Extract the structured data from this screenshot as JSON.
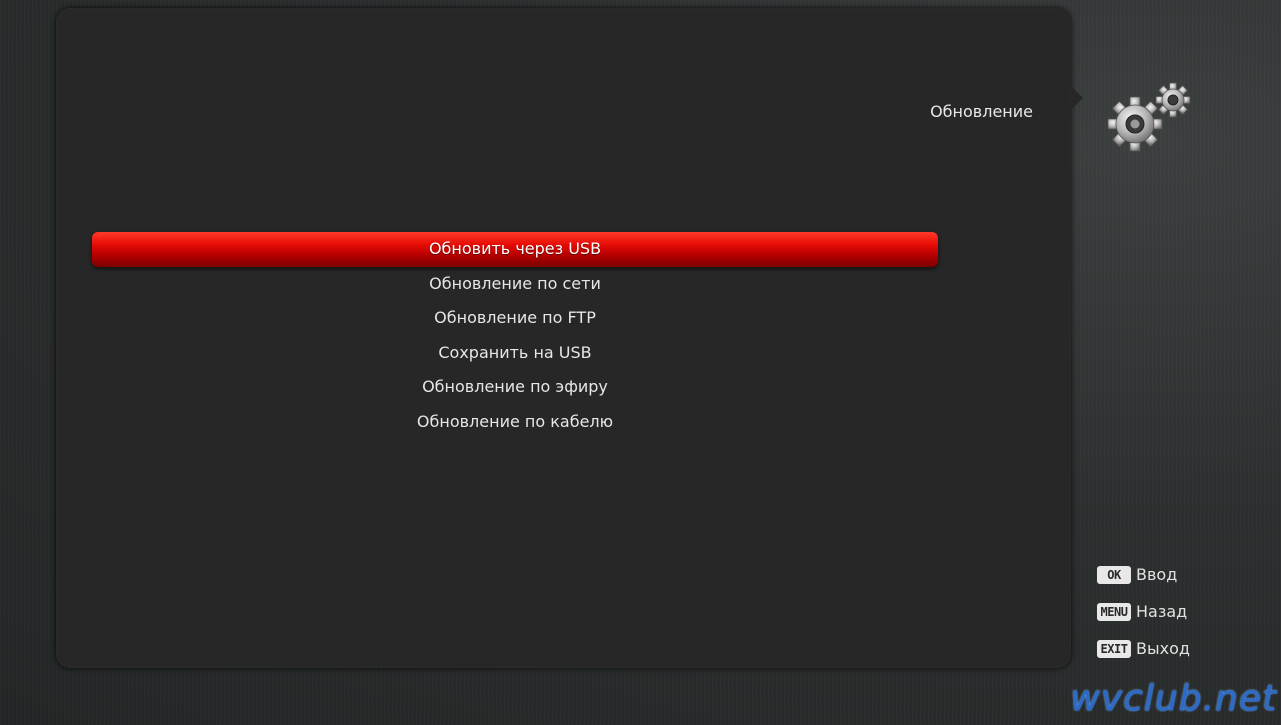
{
  "menu": {
    "title": "Обновление",
    "items": [
      {
        "label": "Обновить через USB",
        "selected": true
      },
      {
        "label": "Обновление по сети",
        "selected": false
      },
      {
        "label": "Обновление по FTP",
        "selected": false
      },
      {
        "label": "Сохранить на USB",
        "selected": false
      },
      {
        "label": "Обновление по эфиру",
        "selected": false
      },
      {
        "label": "Обновление по кабелю",
        "selected": false
      }
    ]
  },
  "header": {
    "icon": "gears-icon"
  },
  "hints": [
    {
      "key": "OK",
      "label": "Ввод"
    },
    {
      "key": "MENU",
      "label": "Назад"
    },
    {
      "key": "EXIT",
      "label": "Выход"
    }
  ],
  "watermark": "wvclub.net",
  "colors": {
    "selected": "#e00a05",
    "panel": "#272727",
    "text": "#e6e6e6",
    "watermark": "#2c6fd0"
  }
}
